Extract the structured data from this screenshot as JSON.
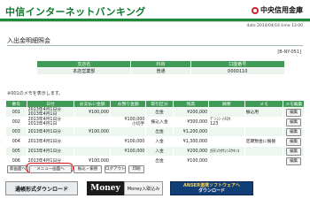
{
  "header": {
    "app_title": "中信インターネットバンキング",
    "bank_name": "中央信用金庫",
    "datetime": "date 2014/04/16 time 13:00"
  },
  "page": {
    "heading": "入出金明細照会",
    "screen_id": "[B-NY-051]",
    "note": "※001のメモを表示します。"
  },
  "account_table": {
    "headers": [
      "支店名",
      "科目",
      "口座番号"
    ],
    "row": [
      "本店営業部",
      "普通",
      "0000110"
    ]
  },
  "history": {
    "headers": [
      "番号",
      "日付",
      "お支払い金額",
      "お預り金額",
      "取引区分",
      "残高",
      "摘要",
      "メモ",
      "メモ編集"
    ],
    "rows": [
      {
        "no": "001",
        "date": "2013年4月1日分\n2013年4月1日",
        "pay": "¥100,000",
        "dep": "",
        "type": "出金",
        "bal": "¥200,000",
        "desc": "",
        "memo": "振込用",
        "edit": "編集"
      },
      {
        "no": "002",
        "date": "2013年4月1日分\n2013年4月1日",
        "pay": "",
        "dep": "¥100,000\n小切手",
        "type": "振込入金",
        "bal": "¥300,000",
        "desc": "ﾃﾞﾝｼﾝ ｲﾁﾛｳ\n123",
        "memo": "",
        "edit": "編集"
      },
      {
        "no": "003",
        "date": "2013年4月1日分",
        "pay": "¥100,000",
        "dep": "",
        "type": "出金",
        "bal": "¥1,200,000",
        "desc": "",
        "memo": "",
        "edit": "編集"
      },
      {
        "no": "004",
        "date": "2013年4月1日分",
        "pay": "",
        "dep": "¥100,000",
        "type": "入金",
        "bal": "¥1,300,000",
        "desc": "",
        "memo": "定期預金に振替",
        "edit": "編集"
      },
      {
        "no": "005",
        "date": "2013年4月1日分",
        "pay": "",
        "dep": "¥100,000",
        "type": "入金",
        "bal": "¥200,000",
        "desc": "ｶ)ﾁｭｳｵｳｼﾝﾖｳｷﾝｺ",
        "memo": "",
        "edit": "編集"
      },
      {
        "no": "006",
        "date": "2013年4月1日分",
        "pay": "¥100,000",
        "dep": "",
        "type": "出金",
        "bal": "¥100,000",
        "desc": "",
        "memo": "",
        "edit": "編集"
      }
    ]
  },
  "buttons": {
    "new_query": "新画面へ",
    "menu": "メニュー画面へ",
    "transfer": "振込・振替",
    "print": "印刷",
    "logout": "ログアウト"
  },
  "banners": {
    "csv_download": "通帳形式ダウンロード",
    "money": "Money",
    "money_import": "Money入取込み",
    "answer_line1": "ANSER連携ソフトウェアへ",
    "answer_line2": "ダウンロード"
  }
}
